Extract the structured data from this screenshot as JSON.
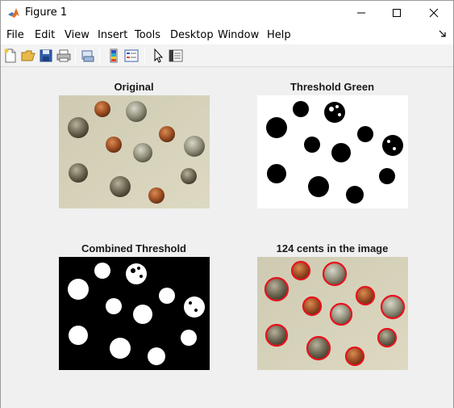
{
  "window": {
    "title": "Figure 1",
    "app_icon": "matlab-icon",
    "controls": [
      "minimize-icon",
      "maximize-icon",
      "close-icon"
    ]
  },
  "menubar": {
    "items": [
      "File",
      "Edit",
      "View",
      "Insert",
      "Tools",
      "Desktop",
      "Window",
      "Help"
    ]
  },
  "toolbar": {
    "buttons": [
      "new-figure-icon",
      "open-file-icon",
      "save-icon",
      "print-icon",
      "print-preview-icon",
      "colorbar-icon",
      "legend-icon",
      "pointer-icon",
      "property-inspector-icon"
    ]
  },
  "axes": [
    {
      "title": "Original",
      "image": "coins-photo"
    },
    {
      "title": "Threshold Green",
      "image": "threshold-green-mask"
    },
    {
      "title": "Combined Threshold",
      "image": "combined-threshold-mask"
    },
    {
      "title": "124 cents in the image",
      "image": "coins-detected"
    }
  ],
  "colors": {
    "photo_background": "#d4d2b8",
    "detection_circle": "#e8121e",
    "mask_black": "#000000",
    "mask_white": "#ffffff"
  }
}
